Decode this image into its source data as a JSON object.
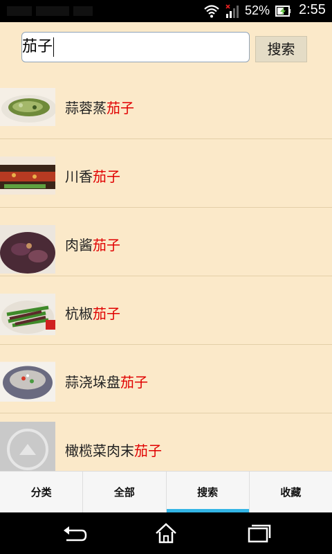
{
  "status_bar": {
    "battery_percent": "52%",
    "time": "2:55",
    "icons": [
      "wifi-icon",
      "signal-icon",
      "battery-charging-icon"
    ]
  },
  "search": {
    "value": "茄子",
    "button_label": "搜索"
  },
  "results": [
    {
      "prefix": "蒜蓉蒸",
      "highlight": "茄子",
      "image": "steamed-eggplant-thumbnail"
    },
    {
      "prefix": "川香",
      "highlight": "茄子",
      "image": "sichuan-eggplant-thumbnail"
    },
    {
      "prefix": "肉酱",
      "highlight": "茄子",
      "image": "meat-sauce-eggplant-thumbnail"
    },
    {
      "prefix": "杭椒",
      "highlight": "茄子",
      "image": "pepper-eggplant-thumbnail"
    },
    {
      "prefix": "蒜浇垛盘",
      "highlight": "茄子",
      "image": "garlic-eggplant-thumbnail"
    },
    {
      "prefix": "橄榄菜肉末",
      "highlight": "茄子",
      "image": "placeholder-thumbnail"
    }
  ],
  "tabs": [
    {
      "label": "分类",
      "active": false
    },
    {
      "label": "全部",
      "active": false
    },
    {
      "label": "搜索",
      "active": true
    },
    {
      "label": "收藏",
      "active": false
    }
  ],
  "nav_icons": [
    "back-icon",
    "home-icon",
    "recent-apps-icon"
  ],
  "colors": {
    "background": "#fbe9c9",
    "highlight": "#e00000",
    "tab_indicator": "#33b5e5"
  }
}
